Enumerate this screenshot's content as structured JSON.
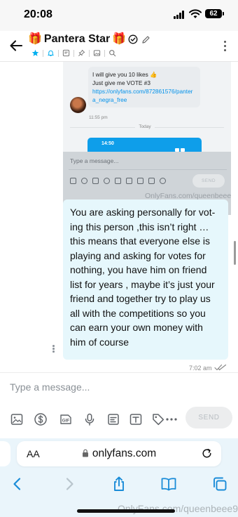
{
  "status_bar": {
    "time": "20:08",
    "battery": "62"
  },
  "header": {
    "title": "Pantera Star",
    "title_prefix_emoji": "🎁",
    "title_suffix_emoji": "🎁",
    "icons": [
      "back-arrow-icon",
      "verified-icon",
      "pencil-icon",
      "star-icon",
      "bell-icon",
      "note-icon",
      "pin-icon",
      "image-icon",
      "search-icon",
      "more-options-icon"
    ]
  },
  "embedded_screenshot": {
    "bubble_lines": [
      "I will give you 10 likes 👍",
      "Just give me VOTE #3"
    ],
    "link": "https://onlyfans.com/872861576/pantera_negra_free",
    "time": "11:55 pm",
    "divider": "Today",
    "inner_time": "14:50",
    "input_placeholder": "Type a message...",
    "send_label": "SEND",
    "watermark": "OnlyFans.com/queenbeee9"
  },
  "message": {
    "text": "You are asking personally for vot-\ning this person ,this isn’t right …\nthis means that everyone else is\nplaying and asking for votes for\nnothing, you have him on friend\nlist for years , maybe it’s just your\nfriend and together try to play us\nall with the competitions so you\ncan earn your own money with\nhim of course",
    "time": "7:02 am"
  },
  "composer": {
    "placeholder": "Type a message...",
    "send_label": "SEND",
    "tools": [
      "image-icon",
      "dollar-icon",
      "gif-icon",
      "microphone-icon",
      "poll-icon",
      "text-image-icon",
      "price-tag-icon",
      "more-icon"
    ]
  },
  "browser": {
    "aa_label": "AA",
    "url": "onlyfans.com"
  },
  "watermark": "OnlyFans.com/queenbeee9",
  "colors": {
    "accent": "#00AFF0",
    "bubble_bg": "#E6F7FC",
    "browser_bg": "#EAF5FB"
  }
}
